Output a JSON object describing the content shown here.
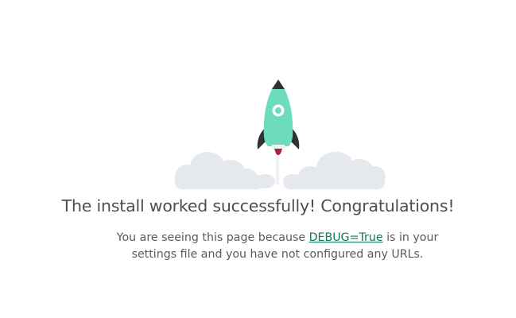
{
  "hero": {
    "illustration": "rocket-launch",
    "colors": {
      "rocket_body": "#6ddcbd",
      "rocket_fins": "#2e3236",
      "flame": "#aa2247",
      "clouds": "#e5e8ec"
    }
  },
  "title": "The install worked successfully! Congratulations!",
  "description": {
    "before_link": "You are seeing this page because ",
    "link_text": "DEBUG=True",
    "after_link": " is in your settings file and you have not configured any URLs."
  },
  "colors": {
    "link": "#0c7a4f",
    "text": "#4d4d4d"
  }
}
